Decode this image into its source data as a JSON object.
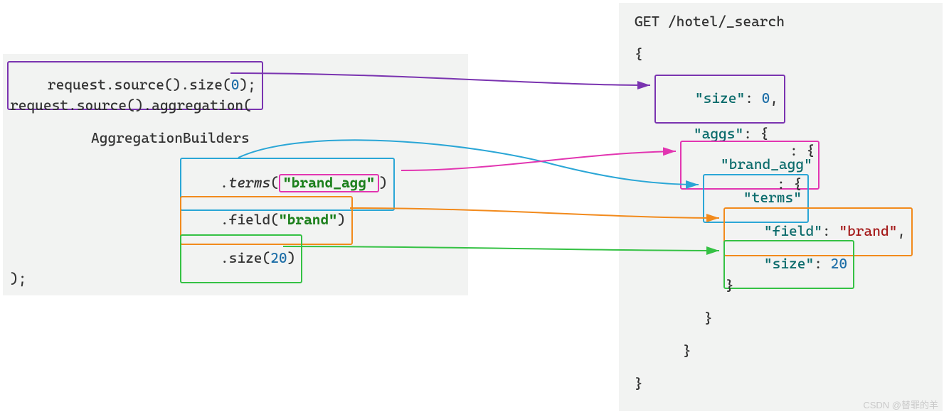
{
  "java": {
    "line1_a": "request.source().size(",
    "line1_b": "0",
    "line1_c": ");",
    "line2": "request.source().aggregation(",
    "line3": "AggregationBuilders",
    "terms_call": ".terms",
    "terms_arg": "\"brand_agg\"",
    "terms_close": ")",
    "field_a": ".field(",
    "field_b": "\"brand\"",
    "field_c": ")",
    "size_a": ".size(",
    "size_b": "20",
    "size_c": ")",
    "close": ");"
  },
  "json": {
    "l1": "GET /hotel/_search",
    "l2": "{",
    "size_key": "\"size\"",
    "size_sep": ": ",
    "size_val": "0",
    "size_tail": ",",
    "aggs_key": "\"aggs\"",
    "aggs_rest": ": {",
    "brand_key": "\"brand_agg\"",
    "brand_rest": ": {",
    "terms_key": "\"terms\"",
    "terms_rest": ": {",
    "field_key": "\"field\"",
    "field_sep": ": ",
    "field_val": "\"brand\"",
    "field_tail": ",",
    "innersize_key": "\"size\"",
    "innersize_sep": ": ",
    "innersize_val": "20",
    "c1": "}",
    "c2": "}",
    "c3": "}",
    "c4": "}"
  },
  "watermark": "CSDN @替罪的羊",
  "colors": {
    "purple": "#7a33b0",
    "pink": "#e235b1",
    "blue": "#2aa6d6",
    "orange": "#f28a1c",
    "green": "#35c144"
  }
}
